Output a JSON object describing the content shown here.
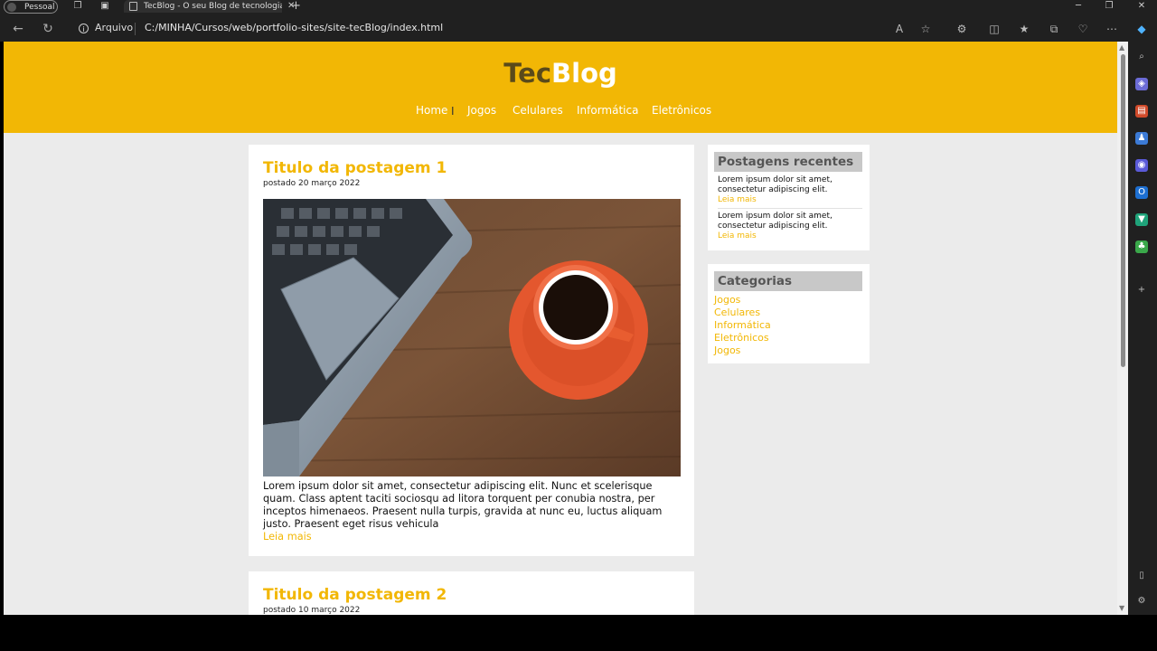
{
  "browser": {
    "profile_label": "Pessoal",
    "tab_title": "TecBlog - O seu Blog de tecnologia",
    "address_scheme": "Arquivo",
    "url": "C:/MINHA/Cursos/web/portfolio-sites/site-tecBlog/index.html"
  },
  "site": {
    "logo_part1": "Tec",
    "logo_part2": "Blog",
    "menu": [
      "Home",
      "Jogos",
      "Celulares",
      "Informática",
      "Eletrônicos"
    ]
  },
  "posts": [
    {
      "title": "Titulo da postagem 1",
      "date": "postado 20 março 2022",
      "body": "Lorem ipsum dolor sit amet, consectetur adipiscing elit. Nunc et scelerisque quam. Class aptent taciti sociosqu ad litora torquent per conubia nostra, per inceptos himenaeos. Praesent nulla turpis, gravida at nunc eu, luctus aliquam justo. Praesent eget risus vehicula",
      "read_more": "Leia mais"
    },
    {
      "title": "Titulo da postagem 2",
      "date": "postado 10 março 2022"
    }
  ],
  "sidebar": {
    "recent_title": "Postagens recentes",
    "recent": [
      {
        "text": "Lorem ipsum dolor sit amet, consectetur adipiscing elit.",
        "more": "Leia mais"
      },
      {
        "text": "Lorem ipsum dolor sit amet, consectetur adipiscing elit.",
        "more": "Leia mais"
      }
    ],
    "categories_title": "Categorias",
    "categories": [
      "Jogos",
      "Celulares",
      "Informática",
      "Eletrônicos",
      "Jogos"
    ]
  },
  "colors": {
    "accent": "#f2b705",
    "page_bg": "#ebebeb"
  }
}
